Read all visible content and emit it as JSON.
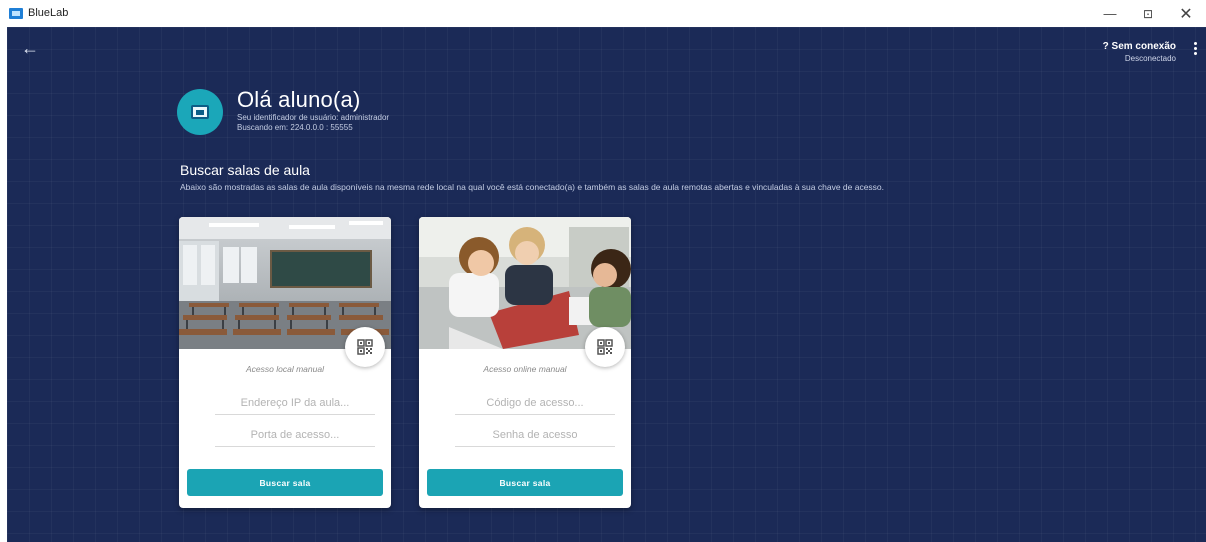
{
  "window": {
    "title": "BlueLab",
    "minimize": "—",
    "maximize": "⊡",
    "close": "✕"
  },
  "nav": {
    "back": "←"
  },
  "connection": {
    "status": "? Sem conexão",
    "detail": "Desconectado"
  },
  "header": {
    "greeting": "Olá aluno(a)",
    "user_id_line": "Seu identificador de usuário: administrador",
    "searching_line": "Buscando em: 224.0.0.0 : 55555"
  },
  "section": {
    "title": "Buscar salas de aula",
    "description": "Abaixo são mostradas as salas de aula disponíveis na mesma rede local na qual você está conectado(a) e também as salas de aula remotas abertas e vinculadas à sua chave de acesso."
  },
  "cards": [
    {
      "label": "Acesso local manual",
      "field1_placeholder": "Endereço IP da aula...",
      "field2_placeholder": "Porta de acesso...",
      "button": "Buscar sala",
      "icon": "qr-code-icon"
    },
    {
      "label": "Acesso online manual",
      "field1_placeholder": "Código de acesso...",
      "field2_placeholder": "Senha de acesso",
      "button": "Buscar sala",
      "icon": "qr-code-icon"
    }
  ],
  "colors": {
    "background": "#1b2a57",
    "accent": "#1ba4b4",
    "avatar": "#1ba7b9"
  }
}
